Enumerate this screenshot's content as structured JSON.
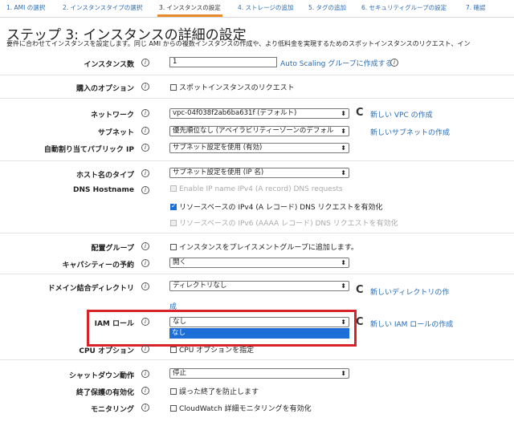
{
  "tabs": [
    {
      "label": "1. AMI の選択"
    },
    {
      "label": "2. インスタンスタイプの選択"
    },
    {
      "label": "3. インスタンスの設定"
    },
    {
      "label": "4. ストレージの追加"
    },
    {
      "label": "5. タグの追加"
    },
    {
      "label": "6. セキュリティグループの設定"
    },
    {
      "label": "7. 確認"
    }
  ],
  "page": {
    "title": "ステップ 3: インスタンスの詳細の設定",
    "description": "要件に合わせてインスタンスを設定します。同じ AMI からの複数インスタンスの作成や、より低料金を実現するためのスポットインスタンスのリクエスト、イン"
  },
  "fields": {
    "instance_count": {
      "label": "インスタンス数",
      "value": "1",
      "link": "Auto Scaling グループに作成する"
    },
    "purchase_option": {
      "label": "購入のオプション",
      "checkbox": "スポットインスタンスのリクエスト"
    },
    "network": {
      "label": "ネットワーク",
      "value": "vpc-04f038f2ab6ba631f (デフォルト)",
      "link": "新しい VPC の作成"
    },
    "subnet": {
      "label": "サブネット",
      "value": "優先順位なし (アベイラビリティーゾーンのデフォル",
      "link": "新しいサブネットの作成"
    },
    "auto_public_ip": {
      "label": "自動割り当てパブリック IP",
      "value": "サブネット設定を使用 (有効)"
    },
    "hostname_type": {
      "label": "ホスト名のタイプ",
      "value": "サブネット設定を使用 (IP 名)"
    },
    "dns_hostname": {
      "label": "DNS Hostname",
      "opt1": "Enable IP name IPv4 (A record) DNS requests",
      "opt2": "リソースベースの IPv4 (A レコード) DNS リクエストを有効化",
      "opt3": "リソースベースの IPv6 (AAAA レコード) DNS リクエストを有効化"
    },
    "placement_group": {
      "label": "配置グループ",
      "checkbox": "インスタンスをプレイスメントグループに追加します。"
    },
    "capacity_reservation": {
      "label": "キャパシティーの予約",
      "value": "開く"
    },
    "domain_directory": {
      "label": "ドメイン結合ディレクトリ",
      "value": "ディレクトリなし",
      "link_line1": "新しいディレクトリの作",
      "link_line2": "成"
    },
    "iam_role": {
      "label": "IAM ロール",
      "value": "なし",
      "dropdown_option": "なし",
      "link": "新しい IAM ロールの作成"
    },
    "cpu_options": {
      "label": "CPU オプション",
      "checkbox": "CPU オプションを指定"
    },
    "shutdown_behavior": {
      "label": "シャットダウン動作",
      "value": "停止"
    },
    "termination_protection": {
      "label": "終了保護の有効化",
      "checkbox": "誤った終了を防止します"
    },
    "monitoring": {
      "label": "モニタリング",
      "checkbox": "CloudWatch 詳細モニタリングを有効化"
    }
  },
  "icons": {
    "info": "i",
    "refresh": "C",
    "caret": "⬍"
  },
  "colors": {
    "link": "#2a6bb3",
    "highlight": "#d8232a",
    "selected_option": "#1e6ed8",
    "active_tab": "#e98b2b"
  }
}
